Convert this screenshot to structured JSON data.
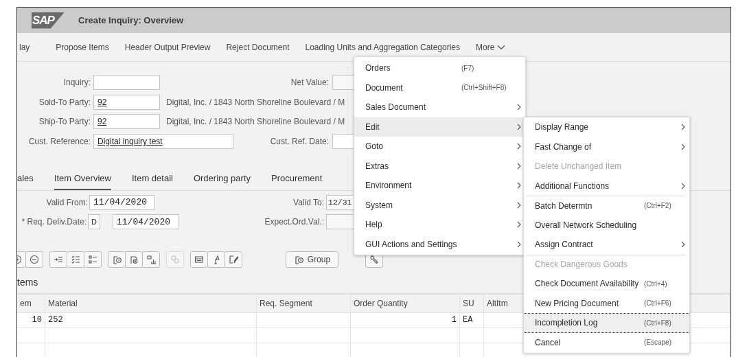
{
  "window": {
    "logo": "SAP",
    "title": "Create Inquiry: Overview"
  },
  "toolbar": [
    {
      "kind": "button",
      "label": "lay"
    },
    {
      "kind": "button",
      "label": "Propose Items"
    },
    {
      "kind": "button",
      "label": "Header Output Preview"
    },
    {
      "kind": "button",
      "label": "Reject Document"
    },
    {
      "kind": "button",
      "label": "Loading Units and Aggregation Categories"
    },
    {
      "kind": "menu",
      "label": "More"
    }
  ],
  "header": {
    "inquiry": {
      "label": "Inquiry:"
    },
    "net_value": {
      "label": "Net Value:"
    },
    "sold_to": {
      "label": "Sold-To Party:",
      "value": "92",
      "description": "Digital, Inc. / 1843 North Shoreline Boulevard / M"
    },
    "ship_to": {
      "label": "Ship-To Party:",
      "value": "92",
      "description": "Digital, Inc. / 1843 North Shoreline Boulevard / M"
    },
    "cust_reference": {
      "label": "Cust. Reference:",
      "value": "Digital inquiry test"
    },
    "cust_ref_date": {
      "label": "Cust. Ref. Date:"
    }
  },
  "tabs": [
    {
      "label": "ales",
      "selected": false
    },
    {
      "label": "Item Overview",
      "selected": true
    },
    {
      "label": "Item detail",
      "selected": false
    },
    {
      "label": "Ordering party",
      "selected": false
    },
    {
      "label": "Procurement",
      "selected": false
    }
  ],
  "item_overview": {
    "valid_from": {
      "label": "Valid From:",
      "value": "11/04/2020"
    },
    "valid_to": {
      "label": "Valid To:",
      "value": "12/31"
    },
    "req_deliv_date": {
      "label": "* Req. Deliv.Date:",
      "period": "D",
      "value": "11/04/2020"
    },
    "expect_ord_val": {
      "label": "Expect.Ord.Val.:"
    }
  },
  "item_toolbar": {
    "groups": [
      [
        {
          "disabled": false
        },
        {
          "disabled": false
        }
      ],
      [
        {
          "disabled": false
        },
        {
          "disabled": false
        },
        {
          "disabled": false
        }
      ],
      [
        {
          "disabled": false
        },
        {
          "disabled": false
        },
        {
          "disabled": false
        }
      ],
      [
        {
          "disabled": true
        }
      ],
      [
        {
          "disabled": false
        },
        {
          "disabled": false
        },
        {
          "disabled": false
        }
      ]
    ],
    "group_button": "Group"
  },
  "items_table": {
    "title": "tems",
    "columns": [
      "em",
      "Material",
      "Req. Segment",
      "Order Quantity",
      "SU",
      "AltItm"
    ],
    "rows": [
      {
        "item": "10",
        "material": "252",
        "order_quantity": "1",
        "su": "EA"
      }
    ]
  },
  "menus": [
    {
      "items": [
        {
          "label": "Orders",
          "shortcut": "(F7)",
          "submenu": false,
          "disabled": false,
          "selected": false,
          "divider_above": false
        },
        {
          "label": "Document",
          "shortcut": "(Ctrl+Shift+F8)",
          "submenu": false,
          "disabled": false,
          "selected": false,
          "divider_above": false
        },
        {
          "label": "Sales Document",
          "submenu": true,
          "disabled": false,
          "selected": false,
          "divider_above": false
        },
        {
          "label": "Edit",
          "submenu": true,
          "disabled": false,
          "selected": true,
          "divider_above": false
        },
        {
          "label": "Goto",
          "submenu": true,
          "disabled": false,
          "selected": false,
          "divider_above": false
        },
        {
          "label": "Extras",
          "submenu": true,
          "disabled": false,
          "selected": false,
          "divider_above": false
        },
        {
          "label": "Environment",
          "submenu": true,
          "disabled": false,
          "selected": false,
          "divider_above": false
        },
        {
          "label": "System",
          "submenu": true,
          "disabled": false,
          "selected": false,
          "divider_above": false
        },
        {
          "label": "Help",
          "submenu": true,
          "disabled": false,
          "selected": false,
          "divider_above": false
        },
        {
          "label": "GUI Actions and Settings",
          "submenu": true,
          "disabled": false,
          "selected": false,
          "divider_above": false
        }
      ]
    },
    {
      "items": [
        {
          "label": "Display Range",
          "submenu": true,
          "disabled": false,
          "selected": false,
          "divider_above": false
        },
        {
          "label": "Fast Change of",
          "submenu": true,
          "disabled": false,
          "selected": false,
          "divider_above": false
        },
        {
          "label": "Delete Unchanged Item",
          "submenu": false,
          "disabled": true,
          "selected": false,
          "divider_above": false
        },
        {
          "label": "Additional Functions",
          "submenu": true,
          "disabled": false,
          "selected": false,
          "divider_above": false
        },
        {
          "label": "Batch Determtn",
          "shortcut": "(Ctrl+F2)",
          "submenu": false,
          "disabled": false,
          "selected": false,
          "divider_above": true
        },
        {
          "label": "Overall Network Scheduling",
          "submenu": false,
          "disabled": false,
          "selected": false,
          "divider_above": false
        },
        {
          "label": "Assign Contract",
          "submenu": true,
          "disabled": false,
          "selected": false,
          "divider_above": false
        },
        {
          "label": "Check Dangerous Goods",
          "submenu": false,
          "disabled": true,
          "selected": false,
          "divider_above": true
        },
        {
          "label": "Check Document Availability",
          "shortcut": "(Ctrl+4)",
          "submenu": false,
          "disabled": false,
          "selected": false,
          "divider_above": false
        },
        {
          "label": "New Pricing Document",
          "shortcut": "(Ctrl+F6)",
          "submenu": false,
          "disabled": false,
          "selected": false,
          "divider_above": false
        },
        {
          "label": "Incompletion Log",
          "shortcut": "(Ctrl+F8)",
          "submenu": false,
          "disabled": false,
          "selected": true,
          "divider_above": false
        },
        {
          "label": "Cancel",
          "shortcut": "(Escape)",
          "submenu": false,
          "disabled": false,
          "selected": false,
          "divider_above": false
        }
      ]
    }
  ]
}
